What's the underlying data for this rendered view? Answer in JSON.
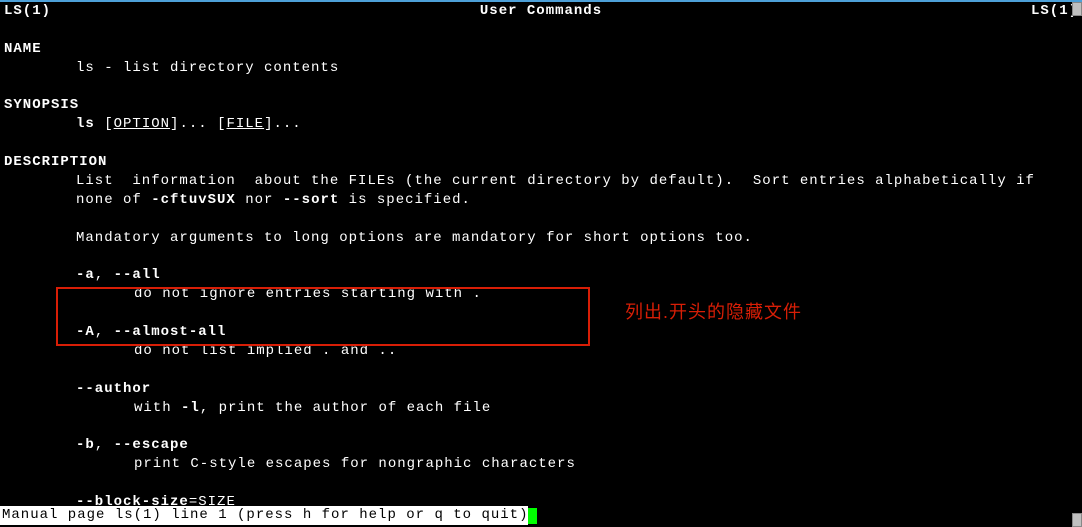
{
  "header": {
    "left": "LS(1)",
    "center": "User Commands",
    "right": "LS(1)"
  },
  "sections": {
    "name": {
      "title": "NAME",
      "body": "ls - list directory contents"
    },
    "synopsis": {
      "title": "SYNOPSIS",
      "cmd": "ls",
      "args": [
        {
          "lb": "[",
          "v": "OPTION",
          "rb": "]... "
        },
        {
          "lb": "[",
          "v": "FILE",
          "rb": "]..."
        }
      ]
    },
    "description": {
      "title": "DESCRIPTION",
      "para1a": "List  information  about the FILEs (the current directory by default).  Sort entries alphabetically if",
      "para1b_pre": "none of ",
      "para1b_bold1": "-cftuvSUX",
      "para1b_mid": " nor ",
      "para1b_bold2": "--sort",
      "para1b_post": " is specified.",
      "para2": "Mandatory arguments to long options are mandatory for short options too."
    },
    "options": [
      {
        "flags_a": "-a",
        "sep": ", ",
        "flags_b": "--all",
        "desc": "do not ignore entries starting with ."
      },
      {
        "flags_a": "-A",
        "sep": ", ",
        "flags_b": "--almost-all",
        "desc": "do not list implied . and .."
      },
      {
        "flags_a": "",
        "sep": "",
        "flags_b": "--author",
        "desc_pre": "with ",
        "desc_bold": "-l",
        "desc_post": ", print the author of each file"
      },
      {
        "flags_a": "-b",
        "sep": ", ",
        "flags_b": "--escape",
        "desc": "print C-style escapes for nongraphic characters"
      },
      {
        "flags_a": "",
        "sep": "",
        "flags_b": "--block-size",
        "eq": "=",
        "arg": "SIZE"
      }
    ]
  },
  "annotation": "列出.开头的隐藏文件",
  "status": "Manual page ls(1) line 1 (press h for help or q to quit)"
}
